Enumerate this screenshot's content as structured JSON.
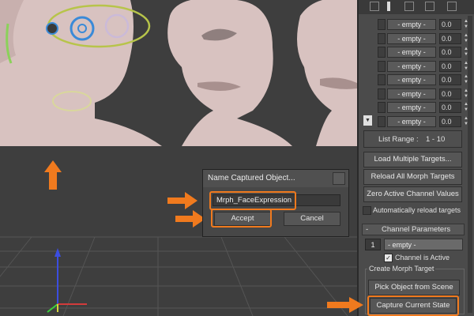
{
  "toolbar_icons": [
    "pin-icon",
    "pipe-icon",
    "list-icon",
    "trash-icon",
    "sliders-icon"
  ],
  "channels": [
    {
      "name": "- empty -",
      "value": "0.0"
    },
    {
      "name": "- empty -",
      "value": "0.0"
    },
    {
      "name": "- empty -",
      "value": "0.0"
    },
    {
      "name": "- empty -",
      "value": "0.0"
    },
    {
      "name": "- empty -",
      "value": "0.0"
    },
    {
      "name": "- empty -",
      "value": "0.0"
    },
    {
      "name": "- empty -",
      "value": "0.0"
    },
    {
      "name": "- empty -",
      "value": "0.0"
    }
  ],
  "list_range": {
    "label": "List Range :",
    "value": "1 - 10"
  },
  "buttons": {
    "load_multiple": "Load Multiple Targets...",
    "reload_all": "Reload All Morph Targets",
    "zero_active": "Zero Active Channel Values",
    "pick_object": "Pick Object from Scene",
    "capture_state": "Capture Current State"
  },
  "auto_reload": {
    "label": "Automatically reload targets",
    "checked": false
  },
  "channel_params": {
    "title": "Channel Parameters",
    "rollout_sign": "-",
    "channel_number": "1",
    "channel_name": "- empty -",
    "active_label": "Channel is Active",
    "active_checked": true,
    "create_group": "Create Morph Target"
  },
  "dialog": {
    "title": "Name Captured Object...",
    "input_value": "Mrph_FaceExpression",
    "accept": "Accept",
    "cancel": "Cancel"
  },
  "colors": {
    "highlight": "#f07a1e",
    "panel": "#4b4b4b",
    "viewport": "#3e3e3e"
  }
}
